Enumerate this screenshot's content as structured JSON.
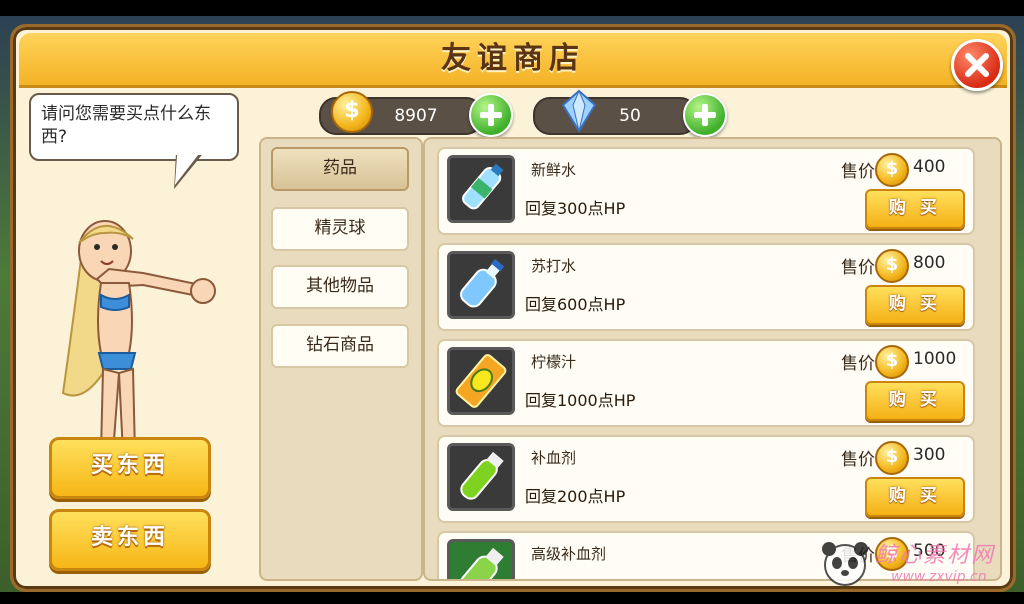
{
  "shop": {
    "title": "友谊商店",
    "npc_speech": "请问您需要买点什么东西?",
    "currency": {
      "gold": "8907",
      "gems": "50"
    },
    "buy_mode_label": "买东西",
    "sell_mode_label": "卖东西",
    "categories": [
      {
        "label": "药品",
        "selected": true
      },
      {
        "label": "精灵球",
        "selected": false
      },
      {
        "label": "其他物品",
        "selected": false
      },
      {
        "label": "钻石商品",
        "selected": false
      }
    ],
    "price_label": "售价",
    "buy_button_label": "购 买",
    "items": [
      {
        "name": "新鲜水",
        "desc": "回复300点HP",
        "price": "400",
        "icon": "water-bottle-icon"
      },
      {
        "name": "苏打水",
        "desc": "回复600点HP",
        "price": "800",
        "icon": "soda-bottle-icon"
      },
      {
        "name": "柠檬汁",
        "desc": "回复1000点HP",
        "price": "1000",
        "icon": "lemonade-can-icon"
      },
      {
        "name": "补血剂",
        "desc": "回复200点HP",
        "price": "300",
        "icon": "potion-vial-icon"
      },
      {
        "name": "高级补血剂",
        "desc": "",
        "price": "500",
        "icon": "super-potion-icon"
      }
    ]
  },
  "watermark": {
    "text": "鲸心素材网",
    "url": "www.zxvip.cn"
  },
  "colors": {
    "panel_bg": "#fbf2d8",
    "title_bar": "#f3b226",
    "buy_button": "#f5b016",
    "plus_green": "#3fb02b",
    "close_red": "#d82b14"
  }
}
